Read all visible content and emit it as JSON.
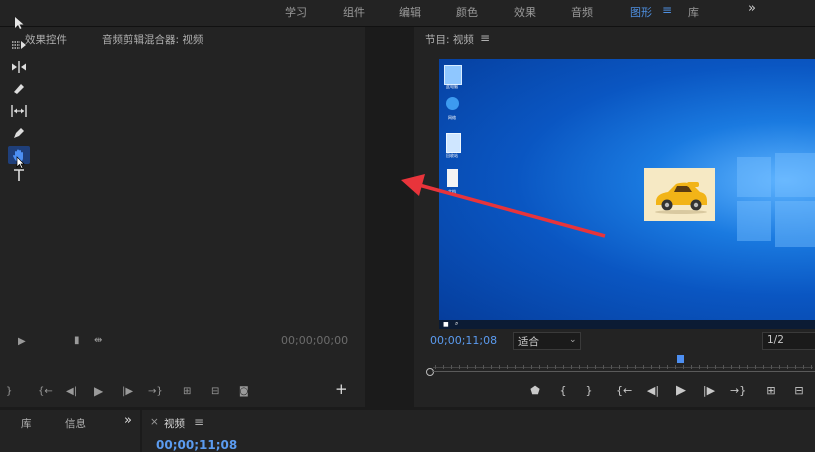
{
  "workspace_tabs": [
    "学习",
    "组件",
    "编辑",
    "颜色",
    "效果",
    "音频",
    "图形",
    "库"
  ],
  "workspace_more": "»",
  "left_panel": {
    "tab_effects": "效果控件",
    "tab_mixer": "音频剪辑混合器: 视频",
    "timecode": "00;00;00;00",
    "add": "+"
  },
  "program": {
    "title": "节目: 视频",
    "menu": "≡",
    "timecode": "00;00;11;08",
    "fit_value": "适合",
    "resolution_value": "1/2"
  },
  "bottom_left": {
    "tab_library": "库",
    "tab_info": "信息",
    "more": "»"
  },
  "timeline": {
    "close": "×",
    "title": "视频",
    "menu": "≡",
    "timecode": "00;00;11;08"
  },
  "desktop_icons": [
    "此电脑",
    "网络",
    "回收站",
    "文档"
  ],
  "colors": {
    "accent": "#4e8fe0",
    "arrow": "#e8343b",
    "desktop": "#0a56c2"
  }
}
